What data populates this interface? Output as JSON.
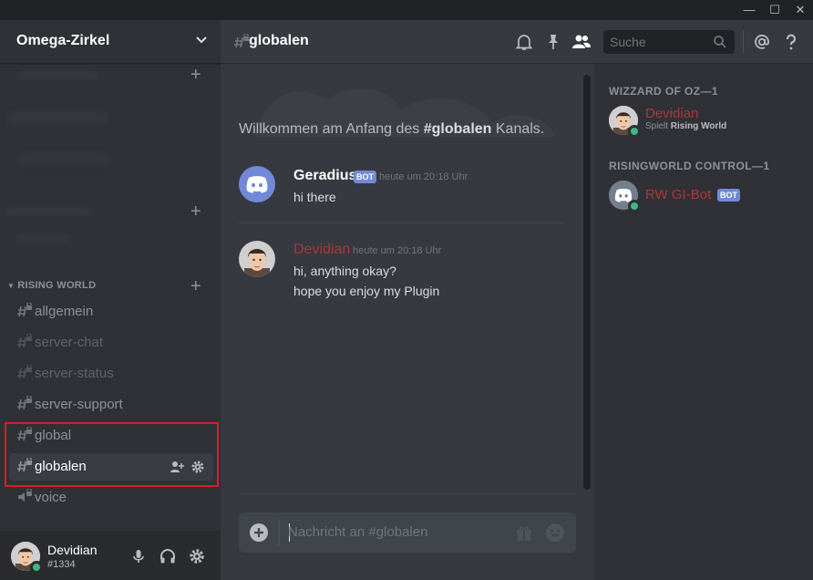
{
  "window": {
    "minimize_glyph": "—",
    "maximize_glyph": "☐",
    "close_glyph": "✕"
  },
  "sidebar": {
    "guild_name": "Omega-Zirkel",
    "category": "RISING WORLD",
    "channels": [
      {
        "name": "allgemein",
        "type": "text"
      },
      {
        "name": "server-chat",
        "type": "text"
      },
      {
        "name": "server-status",
        "type": "text"
      },
      {
        "name": "server-support",
        "type": "text"
      },
      {
        "name": "global",
        "type": "text"
      },
      {
        "name": "globalen",
        "type": "text",
        "selected": true
      },
      {
        "name": "voice",
        "type": "voice"
      }
    ]
  },
  "user": {
    "name": "Devidian",
    "discriminator": "#1334"
  },
  "header": {
    "channel": "globalen",
    "search_placeholder": "Suche"
  },
  "chat": {
    "welcome_prefix": "Willkommen am Anfang des ",
    "welcome_channel": "#globalen",
    "welcome_suffix": " Kanals.",
    "messages": [
      {
        "author": "Geradius",
        "bot_tag": "BOT",
        "timestamp": "heute um 20:18 Uhr",
        "lines": [
          "hi there"
        ]
      },
      {
        "author": "Devidian",
        "timestamp": "heute um 20:18 Uhr",
        "lines": [
          "hi, anything okay?",
          "hope you enjoy my Plugin"
        ]
      }
    ],
    "input_placeholder": "Nachricht an #globalen"
  },
  "members": {
    "groups": [
      {
        "role": "WIZZARD OF OZ—1",
        "members": [
          {
            "name": "Devidian",
            "activity_prefix": "Spielt ",
            "activity": "Rising World"
          }
        ]
      },
      {
        "role": "RISINGWORLD CONTROL—1",
        "members": [
          {
            "name": "RW GI-Bot",
            "bot_tag": "BOT"
          }
        ]
      }
    ]
  },
  "colors": {
    "accent": "#7289da",
    "online": "#43b581",
    "role_red": "#a8393b",
    "highlight": "#e01b24"
  }
}
